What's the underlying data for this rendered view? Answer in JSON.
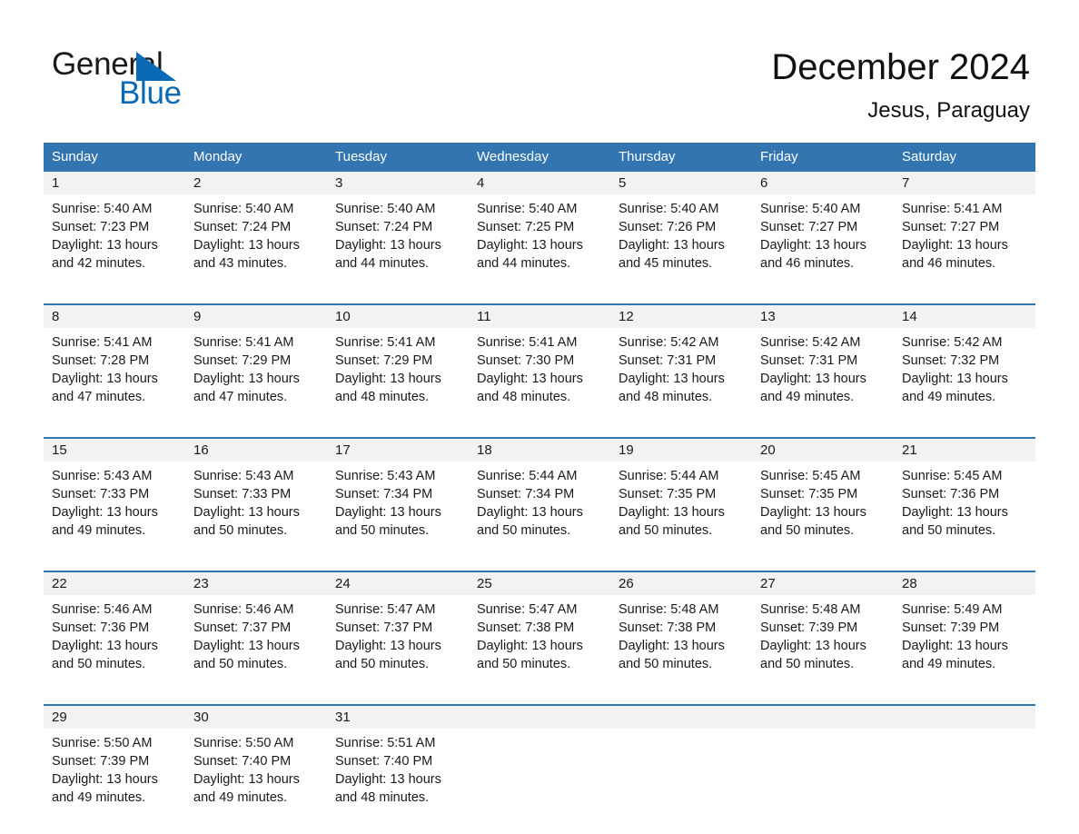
{
  "brand": {
    "name_part1": "General",
    "name_part2": "Blue",
    "triangle_icon": "triangle-icon",
    "colors": {
      "blue": "#0a6ab5",
      "black": "#1a1a1a"
    }
  },
  "header": {
    "title": "December 2024",
    "subtitle": "Jesus, Paraguay"
  },
  "colors": {
    "header_blue": "#3275b1",
    "daynum_band": "#f2f2f2",
    "text": "#1a1a1a",
    "page_background": "#ffffff"
  },
  "weekdays": [
    "Sunday",
    "Monday",
    "Tuesday",
    "Wednesday",
    "Thursday",
    "Friday",
    "Saturday"
  ],
  "weeks": [
    {
      "days": [
        {
          "day": "1",
          "sunrise": "Sunrise: 5:40 AM",
          "sunset": "Sunset: 7:23 PM",
          "daylight": "Daylight: 13 hours and 42 minutes."
        },
        {
          "day": "2",
          "sunrise": "Sunrise: 5:40 AM",
          "sunset": "Sunset: 7:24 PM",
          "daylight": "Daylight: 13 hours and 43 minutes."
        },
        {
          "day": "3",
          "sunrise": "Sunrise: 5:40 AM",
          "sunset": "Sunset: 7:24 PM",
          "daylight": "Daylight: 13 hours and 44 minutes."
        },
        {
          "day": "4",
          "sunrise": "Sunrise: 5:40 AM",
          "sunset": "Sunset: 7:25 PM",
          "daylight": "Daylight: 13 hours and 44 minutes."
        },
        {
          "day": "5",
          "sunrise": "Sunrise: 5:40 AM",
          "sunset": "Sunset: 7:26 PM",
          "daylight": "Daylight: 13 hours and 45 minutes."
        },
        {
          "day": "6",
          "sunrise": "Sunrise: 5:40 AM",
          "sunset": "Sunset: 7:27 PM",
          "daylight": "Daylight: 13 hours and 46 minutes."
        },
        {
          "day": "7",
          "sunrise": "Sunrise: 5:41 AM",
          "sunset": "Sunset: 7:27 PM",
          "daylight": "Daylight: 13 hours and 46 minutes."
        }
      ]
    },
    {
      "days": [
        {
          "day": "8",
          "sunrise": "Sunrise: 5:41 AM",
          "sunset": "Sunset: 7:28 PM",
          "daylight": "Daylight: 13 hours and 47 minutes."
        },
        {
          "day": "9",
          "sunrise": "Sunrise: 5:41 AM",
          "sunset": "Sunset: 7:29 PM",
          "daylight": "Daylight: 13 hours and 47 minutes."
        },
        {
          "day": "10",
          "sunrise": "Sunrise: 5:41 AM",
          "sunset": "Sunset: 7:29 PM",
          "daylight": "Daylight: 13 hours and 48 minutes."
        },
        {
          "day": "11",
          "sunrise": "Sunrise: 5:41 AM",
          "sunset": "Sunset: 7:30 PM",
          "daylight": "Daylight: 13 hours and 48 minutes."
        },
        {
          "day": "12",
          "sunrise": "Sunrise: 5:42 AM",
          "sunset": "Sunset: 7:31 PM",
          "daylight": "Daylight: 13 hours and 48 minutes."
        },
        {
          "day": "13",
          "sunrise": "Sunrise: 5:42 AM",
          "sunset": "Sunset: 7:31 PM",
          "daylight": "Daylight: 13 hours and 49 minutes."
        },
        {
          "day": "14",
          "sunrise": "Sunrise: 5:42 AM",
          "sunset": "Sunset: 7:32 PM",
          "daylight": "Daylight: 13 hours and 49 minutes."
        }
      ]
    },
    {
      "days": [
        {
          "day": "15",
          "sunrise": "Sunrise: 5:43 AM",
          "sunset": "Sunset: 7:33 PM",
          "daylight": "Daylight: 13 hours and 49 minutes."
        },
        {
          "day": "16",
          "sunrise": "Sunrise: 5:43 AM",
          "sunset": "Sunset: 7:33 PM",
          "daylight": "Daylight: 13 hours and 50 minutes."
        },
        {
          "day": "17",
          "sunrise": "Sunrise: 5:43 AM",
          "sunset": "Sunset: 7:34 PM",
          "daylight": "Daylight: 13 hours and 50 minutes."
        },
        {
          "day": "18",
          "sunrise": "Sunrise: 5:44 AM",
          "sunset": "Sunset: 7:34 PM",
          "daylight": "Daylight: 13 hours and 50 minutes."
        },
        {
          "day": "19",
          "sunrise": "Sunrise: 5:44 AM",
          "sunset": "Sunset: 7:35 PM",
          "daylight": "Daylight: 13 hours and 50 minutes."
        },
        {
          "day": "20",
          "sunrise": "Sunrise: 5:45 AM",
          "sunset": "Sunset: 7:35 PM",
          "daylight": "Daylight: 13 hours and 50 minutes."
        },
        {
          "day": "21",
          "sunrise": "Sunrise: 5:45 AM",
          "sunset": "Sunset: 7:36 PM",
          "daylight": "Daylight: 13 hours and 50 minutes."
        }
      ]
    },
    {
      "days": [
        {
          "day": "22",
          "sunrise": "Sunrise: 5:46 AM",
          "sunset": "Sunset: 7:36 PM",
          "daylight": "Daylight: 13 hours and 50 minutes."
        },
        {
          "day": "23",
          "sunrise": "Sunrise: 5:46 AM",
          "sunset": "Sunset: 7:37 PM",
          "daylight": "Daylight: 13 hours and 50 minutes."
        },
        {
          "day": "24",
          "sunrise": "Sunrise: 5:47 AM",
          "sunset": "Sunset: 7:37 PM",
          "daylight": "Daylight: 13 hours and 50 minutes."
        },
        {
          "day": "25",
          "sunrise": "Sunrise: 5:47 AM",
          "sunset": "Sunset: 7:38 PM",
          "daylight": "Daylight: 13 hours and 50 minutes."
        },
        {
          "day": "26",
          "sunrise": "Sunrise: 5:48 AM",
          "sunset": "Sunset: 7:38 PM",
          "daylight": "Daylight: 13 hours and 50 minutes."
        },
        {
          "day": "27",
          "sunrise": "Sunrise: 5:48 AM",
          "sunset": "Sunset: 7:39 PM",
          "daylight": "Daylight: 13 hours and 50 minutes."
        },
        {
          "day": "28",
          "sunrise": "Sunrise: 5:49 AM",
          "sunset": "Sunset: 7:39 PM",
          "daylight": "Daylight: 13 hours and 49 minutes."
        }
      ]
    },
    {
      "days": [
        {
          "day": "29",
          "sunrise": "Sunrise: 5:50 AM",
          "sunset": "Sunset: 7:39 PM",
          "daylight": "Daylight: 13 hours and 49 minutes."
        },
        {
          "day": "30",
          "sunrise": "Sunrise: 5:50 AM",
          "sunset": "Sunset: 7:40 PM",
          "daylight": "Daylight: 13 hours and 49 minutes."
        },
        {
          "day": "31",
          "sunrise": "Sunrise: 5:51 AM",
          "sunset": "Sunset: 7:40 PM",
          "daylight": "Daylight: 13 hours and 48 minutes."
        },
        {
          "day": "",
          "sunrise": "",
          "sunset": "",
          "daylight": ""
        },
        {
          "day": "",
          "sunrise": "",
          "sunset": "",
          "daylight": ""
        },
        {
          "day": "",
          "sunrise": "",
          "sunset": "",
          "daylight": ""
        },
        {
          "day": "",
          "sunrise": "",
          "sunset": "",
          "daylight": ""
        }
      ]
    }
  ]
}
